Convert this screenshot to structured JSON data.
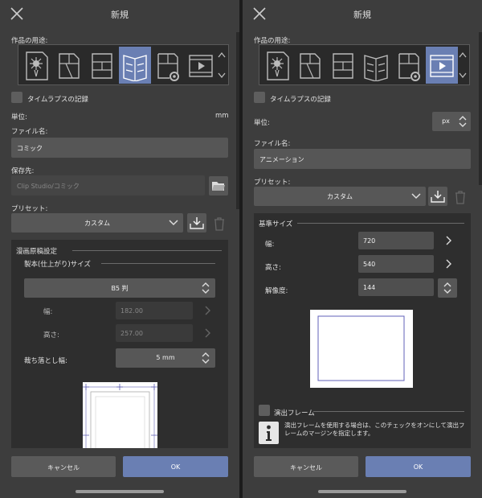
{
  "left": {
    "title": "新規",
    "purpose_label": "作品の用途:",
    "timelapse_label": "タイムラプスの記録",
    "unit_label": "単位:",
    "unit_value": "mm",
    "filename_label": "ファイル名:",
    "filename_value": "コミック",
    "save_label": "保存先:",
    "save_value": "Clip Studio/コミック",
    "preset_label": "プリセット:",
    "preset_value": "カスタム",
    "section_title": "漫画原稿設定",
    "subsection_title": "製本(仕上がり)サイズ",
    "size_value": "B5 判",
    "width_label": "幅:",
    "width_value": "182.00",
    "height_label": "高さ:",
    "height_value": "257.00",
    "bleed_label": "裁ち落とし幅:",
    "bleed_value": "5 mm",
    "cancel_label": "キャンセル",
    "ok_label": "OK"
  },
  "right": {
    "title": "新規",
    "purpose_label": "作品の用途:",
    "timelapse_label": "タイムラプスの記録",
    "unit_label": "単位:",
    "unit_value": "px",
    "filename_label": "ファイル名:",
    "filename_value": "アニメーション",
    "preset_label": "プリセット:",
    "preset_value": "カスタム",
    "section_title": "基準サイズ",
    "width_label": "幅:",
    "width_value": "720",
    "height_label": "高さ:",
    "height_value": "540",
    "resolution_label": "解像度:",
    "resolution_value": "144",
    "frame_label": "演出フレーム",
    "frame_info": "演出フレームを使用する場合は、このチェックをオンにして演出フレームのマージンを指定します。",
    "cancel_label": "キャンセル",
    "ok_label": "OK"
  },
  "colors": {
    "panel": "#3d3d3d",
    "accent": "#6a7fb3",
    "field": "#565656"
  },
  "icons": [
    "close-icon",
    "illustration-icon",
    "comic-icon",
    "comic-page-icon",
    "book-spread-icon",
    "settings-page-icon",
    "animation-icon",
    "folder-icon",
    "save-preset-icon",
    "trash-icon",
    "chevron-down-icon",
    "chevron-right-icon",
    "info-icon"
  ]
}
